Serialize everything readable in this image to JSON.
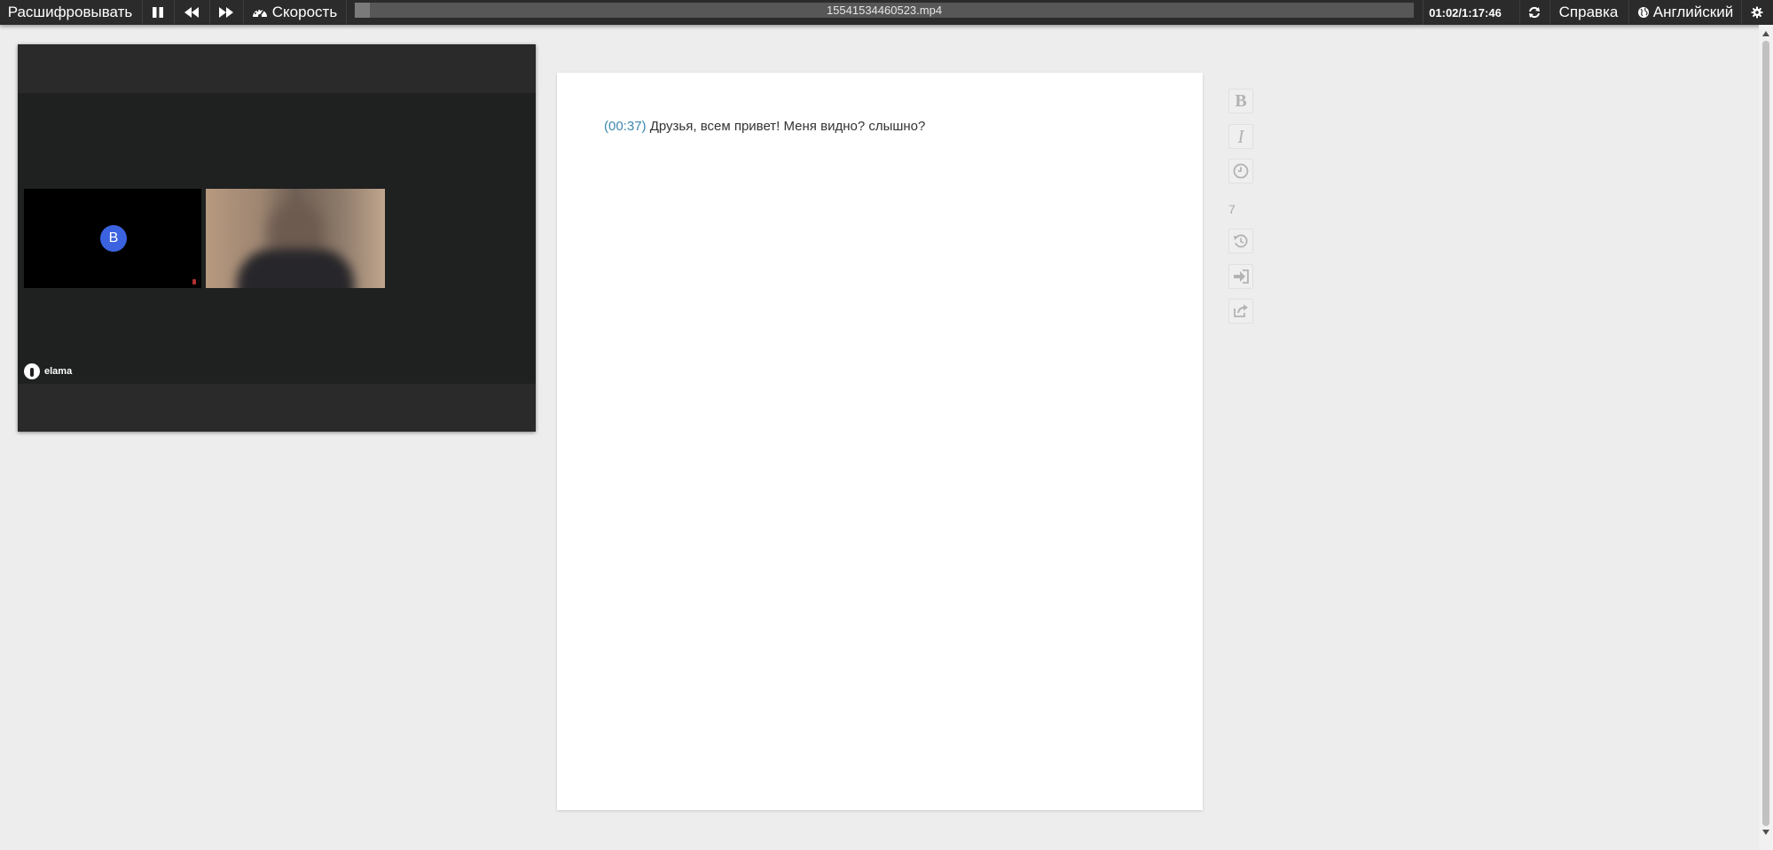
{
  "toolbar": {
    "transcribe_label": "Расшифровывать",
    "speed_label": "Скорость",
    "file_name": "15541534460523.mp4",
    "progress_fraction": 0.014,
    "time_readout": "01:02/1:17:46",
    "help_label": "Справка",
    "language_label": "Английский"
  },
  "video": {
    "participant_initial": "B",
    "brand_name": "elama"
  },
  "document": {
    "lines": [
      {
        "timestamp": "00:37",
        "text": "Друзья, всем привет! Меня видно? слышно?"
      }
    ]
  },
  "side_toolbar": {
    "bold_label": "B",
    "italic_label": "I",
    "font_size": "7"
  },
  "colors": {
    "topbar_bg": "#2b2b2b",
    "timestamp": "#3a87ad",
    "avatar": "#3b63e0"
  },
  "icons": [
    "pause-icon",
    "rewind-icon",
    "fast-forward-icon",
    "dashboard-icon",
    "refresh-icon",
    "globe-icon",
    "gear-icon",
    "clock-icon",
    "history-icon",
    "sign-in-icon",
    "share-icon"
  ]
}
